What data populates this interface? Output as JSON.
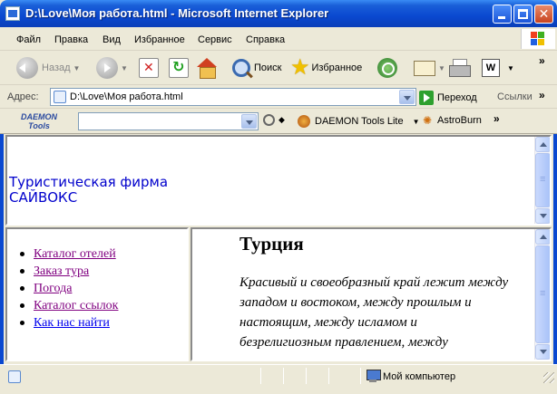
{
  "window": {
    "title": "D:\\Love\\Моя работа.html - Microsoft Internet Explorer"
  },
  "menu": {
    "items": [
      "Файл",
      "Правка",
      "Вид",
      "Избранное",
      "Сервис",
      "Справка"
    ]
  },
  "toolbar": {
    "back_label": "Назад",
    "search_label": "Поиск",
    "favorites_label": "Избранное",
    "more": "»"
  },
  "address_bar": {
    "label": "Адрес:",
    "value": "D:\\Love\\Моя работа.html",
    "go_label": "Переход",
    "links_label": "Ссылки",
    "more": "»"
  },
  "daemon_toolbar": {
    "logo_line1": "DAEMON",
    "logo_line2": "Tools",
    "input_value": "",
    "lite_label": "DAEMON Tools Lite",
    "astroburn_label": "AstroBurn",
    "more": "»"
  },
  "header_frame": {
    "company_line1": "Туристическая фирма",
    "company_line2": "САЙВОКС"
  },
  "nav_frame": {
    "links": [
      {
        "label": "Каталог отелей",
        "visited": true
      },
      {
        "label": "Заказ тура",
        "visited": true
      },
      {
        "label": "Погода",
        "visited": true
      },
      {
        "label": "Каталог ссылок",
        "visited": true
      },
      {
        "label": "Как нас найти",
        "visited": false
      }
    ]
  },
  "content_frame": {
    "title": "Турция",
    "text": "Красивый и своеобразный край лежит между западом и востоком, между прошлым и настоящим, между исламом и безрелигиозным правлением, между консерватизмом и прогрессом."
  },
  "status_bar": {
    "zone_label": "Мой компьютер"
  },
  "colors": {
    "titlebar": "#0a48d0",
    "company_text": "#0000cc",
    "link_visited": "#800080",
    "link_unvisited": "#0000ee"
  }
}
